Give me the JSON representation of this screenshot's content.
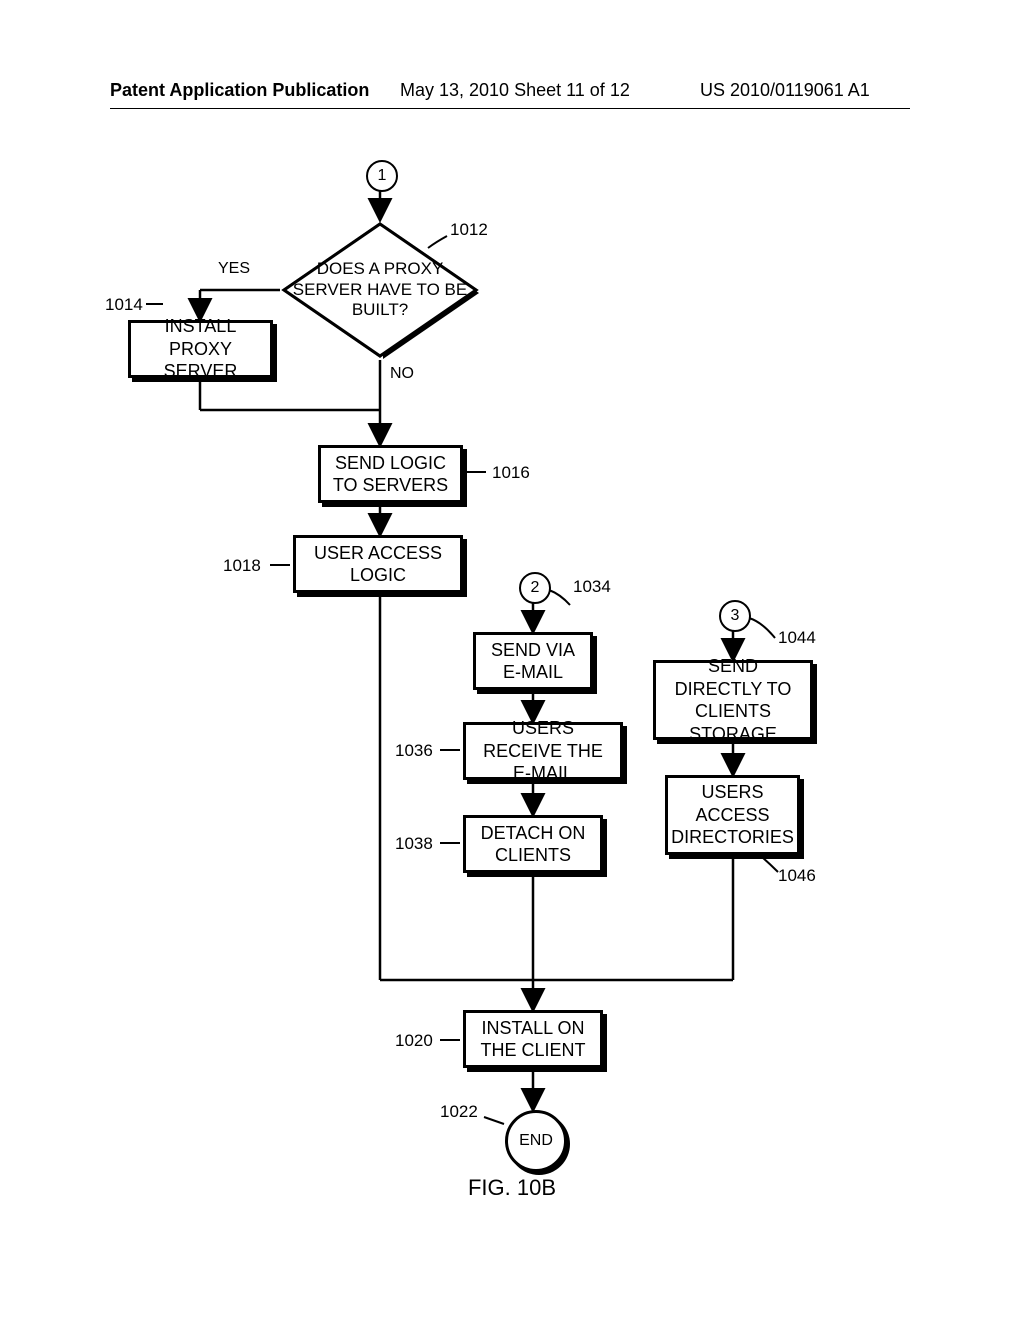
{
  "header": {
    "left": "Patent Application Publication",
    "center": "May 13, 2010  Sheet 11 of 12",
    "right": "US 2010/0119061 A1"
  },
  "connectors": {
    "c1": "1",
    "c2": "2",
    "c3": "3"
  },
  "decision": {
    "text": "DOES A PROXY SERVER HAVE TO BE BUILT?",
    "yes": "YES",
    "no": "NO",
    "ref": "1012"
  },
  "boxes": {
    "b1014": {
      "text": "INSTALL PROXY SERVER",
      "ref": "1014"
    },
    "b1016": {
      "text": "SEND LOGIC TO SERVERS",
      "ref": "1016"
    },
    "b1018": {
      "text": "USER ACCESS LOGIC",
      "ref": "1018"
    },
    "b1034": {
      "text": "SEND VIA E-MAIL",
      "ref": "1034"
    },
    "b1036": {
      "text": "USERS RECEIVE THE E-MAIL",
      "ref": "1036"
    },
    "b1038": {
      "text": "DETACH ON CLIENTS",
      "ref": "1038"
    },
    "b1044": {
      "text": "SEND DIRECTLY TO CLIENTS STORAGE",
      "ref": "1044"
    },
    "b1046": {
      "text": "USERS ACCESS DIRECTORIES",
      "ref": "1046"
    },
    "b1020": {
      "text": "INSTALL ON THE CLIENT",
      "ref": "1020"
    }
  },
  "end": {
    "text": "END",
    "ref": "1022"
  },
  "figure": "FIG. 10B"
}
